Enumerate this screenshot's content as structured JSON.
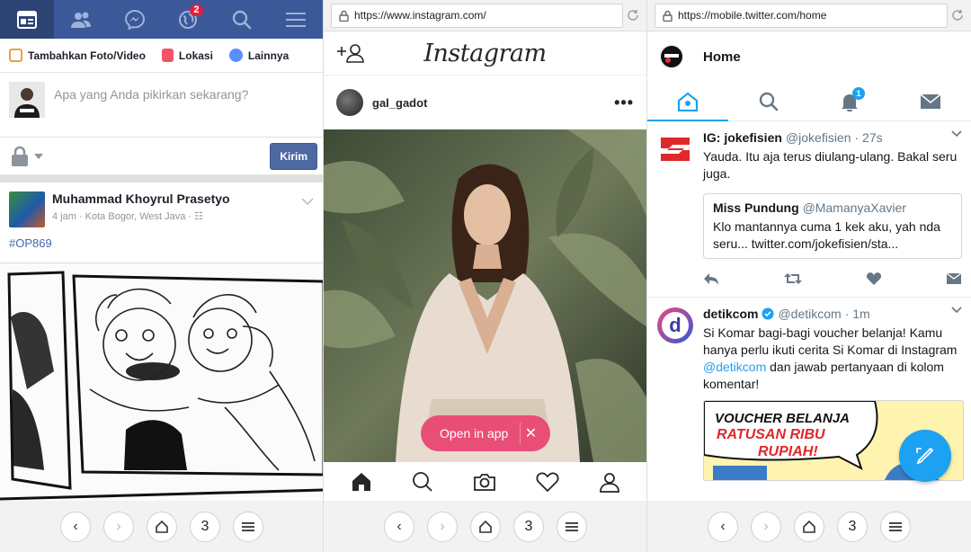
{
  "facebook": {
    "nav": {
      "notifications_badge": "2"
    },
    "actions": {
      "photo_label": "Tambahkan Foto/Video",
      "location_label": "Lokasi",
      "more_label": "Lainnya"
    },
    "composer": {
      "placeholder": "Apa yang Anda pikirkan sekarang?",
      "send_label": "Kirim"
    },
    "post": {
      "author": "Muhammad Khoyrul Prasetyo",
      "meta": "4 jam · Kota Bogor, West Java ·",
      "hashtag": "#OP869"
    },
    "colors": {
      "brand": "#3b5998",
      "link": "#4267b2"
    }
  },
  "instagram": {
    "url": "https://www.instagram.com/",
    "logo": "Instagram",
    "post": {
      "username": "gal_gadot"
    },
    "open_in_app_label": "Open in app",
    "colors": {
      "open_in_app": "#e94e77"
    }
  },
  "twitter": {
    "url": "https://mobile.twitter.com/home",
    "header_title": "Home",
    "notifications_badge": "1",
    "tweets": [
      {
        "name": "IG: jokefisien",
        "handle": "@jokefisien",
        "time": "· 27s",
        "text": "Yauda. Itu aja terus diulang-ulang. Bakal seru juga.",
        "quote": {
          "name": "Miss Pundung",
          "handle": "@MamanyaXavier",
          "text": "Klo mantannya cuma 1 kek aku, yah nda seru... twitter.com/jokefisien/sta..."
        }
      },
      {
        "name": "detikcom",
        "handle": "@detikcom",
        "time": "· 1m",
        "text_before": "Si Komar bagi-bagi voucher belanja! Kamu hanya perlu ikuti cerita Si Komar di Instagram ",
        "mention": "@detikcom",
        "text_after": " dan jawab pertanyaan di kolom komentar!",
        "image_text_1": "VOUCHER BELANJA",
        "image_text_2": "RATUSAN RIBU",
        "image_text_3": "RUPIAH!"
      }
    ],
    "colors": {
      "accent": "#1da1f2"
    }
  },
  "browser": {
    "tab_count": "3"
  }
}
